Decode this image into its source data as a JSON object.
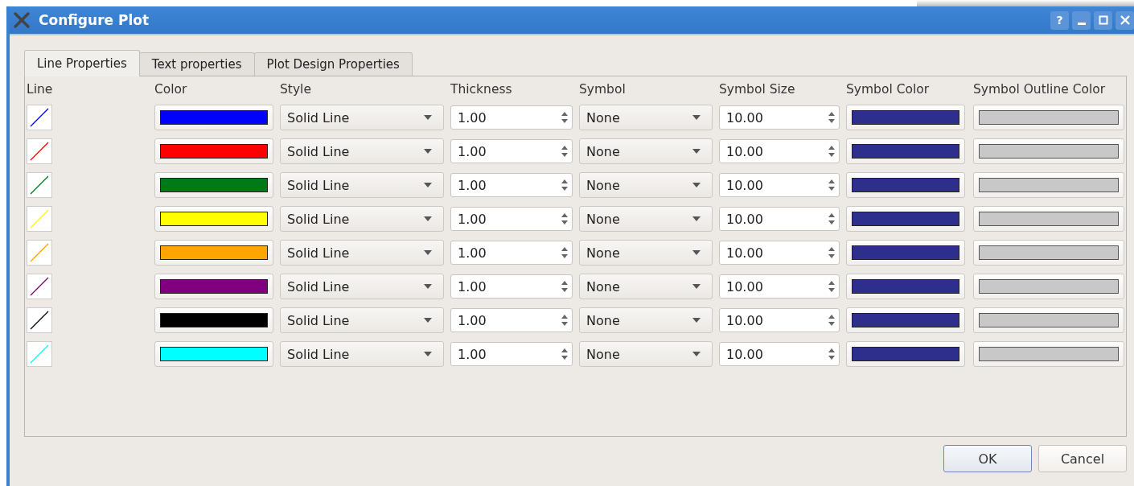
{
  "window": {
    "title": "Configure Plot"
  },
  "title_buttons": [
    {
      "kind": "help",
      "label": "?"
    },
    {
      "kind": "minimize"
    },
    {
      "kind": "maximize"
    },
    {
      "kind": "close"
    }
  ],
  "tabs": [
    {
      "label": "Line Properties",
      "selected": true
    },
    {
      "label": "Text properties",
      "selected": false
    },
    {
      "label": "Plot Design Properties",
      "selected": false
    }
  ],
  "table": {
    "columns": [
      "Line",
      "Color",
      "Style",
      "Thickness",
      "Symbol",
      "Symbol Size",
      "Symbol Color",
      "Symbol Outline Color"
    ],
    "rows": [
      {
        "color": "#0000ff",
        "style": "Solid Line",
        "thickness": "1.00",
        "symbol": "None",
        "symbol_size": "10.00"
      },
      {
        "color": "#ff0000",
        "style": "Solid Line",
        "thickness": "1.00",
        "symbol": "None",
        "symbol_size": "10.00"
      },
      {
        "color": "#007a16",
        "style": "Solid Line",
        "thickness": "1.00",
        "symbol": "None",
        "symbol_size": "10.00"
      },
      {
        "color": "#ffff00",
        "style": "Solid Line",
        "thickness": "1.00",
        "symbol": "None",
        "symbol_size": "10.00"
      },
      {
        "color": "#ffa500",
        "style": "Solid Line",
        "thickness": "1.00",
        "symbol": "None",
        "symbol_size": "10.00"
      },
      {
        "color": "#800080",
        "style": "Solid Line",
        "thickness": "1.00",
        "symbol": "None",
        "symbol_size": "10.00"
      },
      {
        "color": "#000000",
        "style": "Solid Line",
        "thickness": "1.00",
        "symbol": "None",
        "symbol_size": "10.00"
      },
      {
        "color": "#00ffff",
        "style": "Solid Line",
        "thickness": "1.00",
        "symbol": "None",
        "symbol_size": "10.00"
      }
    ]
  },
  "buttons": [
    {
      "label": "OK",
      "selected": true
    },
    {
      "label": "Cancel",
      "selected": false
    }
  ]
}
